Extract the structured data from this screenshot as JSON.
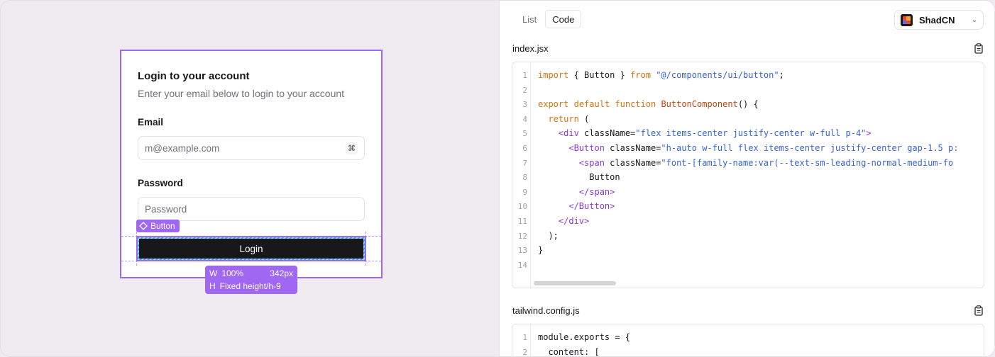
{
  "preview": {
    "card_title": "Login to your account",
    "card_description": "Enter your email below to login to your account",
    "email_label": "Email",
    "email_placeholder": "m@example.com",
    "email_shortcut": "⌘",
    "password_label": "Password",
    "password_placeholder": "Password",
    "login_label": "Login",
    "selection_tag": "Button",
    "size_width_key": "W",
    "size_width_value": "100%",
    "size_width_px": "342px",
    "size_height_key": "H",
    "size_height_value": "Fixed height/h-9"
  },
  "panel": {
    "tabs": [
      {
        "label": "List",
        "active": false
      },
      {
        "label": "Code",
        "active": true
      }
    ],
    "framework": "ShadCN",
    "files": [
      {
        "name": "index.jsx",
        "lines": [
          {
            "n": "1",
            "code": "import { Button } from \"@/components/ui/button\";"
          },
          {
            "n": "2",
            "code": ""
          },
          {
            "n": "3",
            "code": "export default function ButtonComponent() {"
          },
          {
            "n": "4",
            "code": "  return ("
          },
          {
            "n": "5",
            "code": "    <div className=\"flex items-center justify-center w-full p-4\">"
          },
          {
            "n": "6",
            "code": "      <Button className=\"h-auto w-full flex items-center justify-center gap-1.5 p:"
          },
          {
            "n": "7",
            "code": "        <span className=\"font-[family-name:var(--text-sm-leading-normal-medium-fo"
          },
          {
            "n": "8",
            "code": "          Button"
          },
          {
            "n": "9",
            "code": "        </span>"
          },
          {
            "n": "10",
            "code": "      </Button>"
          },
          {
            "n": "11",
            "code": "    </div>"
          },
          {
            "n": "12",
            "code": "  );"
          },
          {
            "n": "13",
            "code": "}"
          },
          {
            "n": "14",
            "code": ""
          }
        ]
      },
      {
        "name": "tailwind.config.js",
        "lines": [
          {
            "n": "1",
            "code": "module.exports = {"
          },
          {
            "n": "2",
            "code": "  content: ["
          }
        ]
      }
    ]
  },
  "colors": {
    "accent": "#a067f2",
    "button_bg": "#18181b",
    "canvas_bg": "#efebf0"
  }
}
